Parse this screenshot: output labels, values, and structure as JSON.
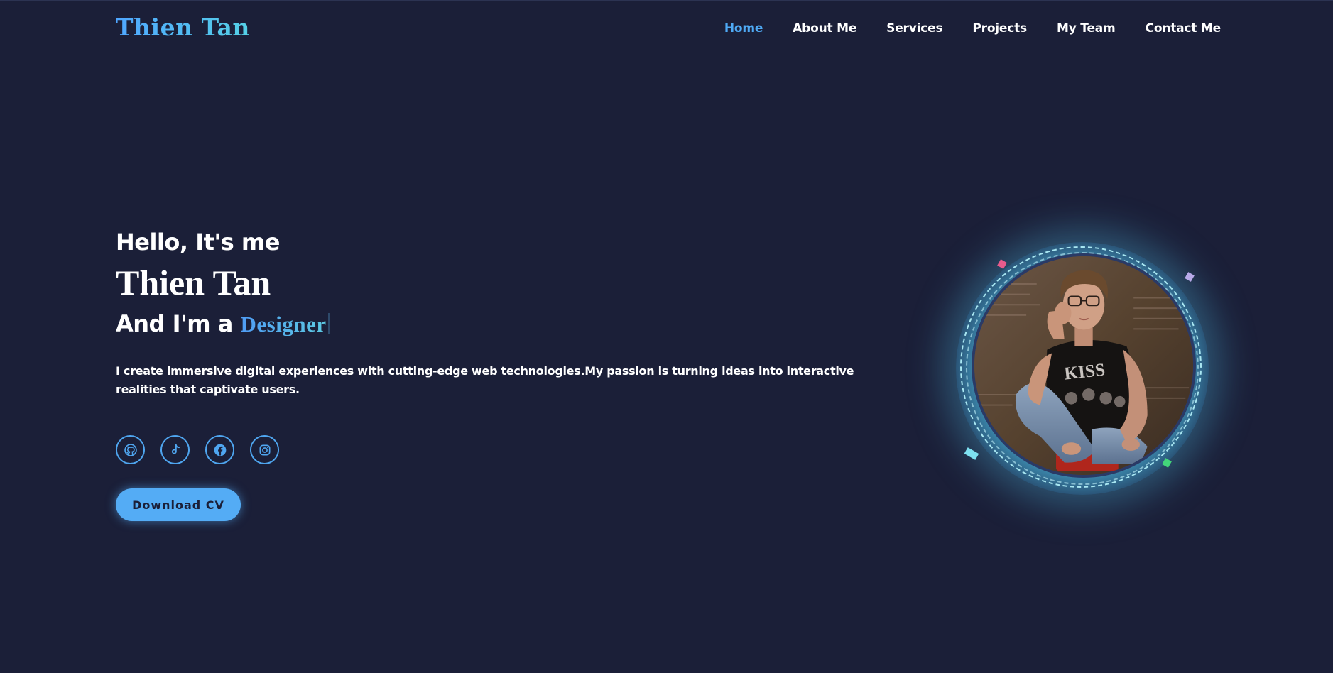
{
  "header": {
    "logo": "Thien Tan",
    "nav": [
      {
        "label": "Home",
        "active": true
      },
      {
        "label": "About Me",
        "active": false
      },
      {
        "label": "Services",
        "active": false
      },
      {
        "label": "Projects",
        "active": false
      },
      {
        "label": "My Team",
        "active": false
      },
      {
        "label": "Contact Me",
        "active": false
      }
    ]
  },
  "hero": {
    "greeting": "Hello, It's me",
    "name": "Thien Tan",
    "role_prefix": "And I'm a ",
    "role": "Designer",
    "description": "I create immersive digital experiences with cutting-edge web technologies.My passion is turning ideas into interactive realities that captivate users.",
    "socials": [
      {
        "icon": "github-icon"
      },
      {
        "icon": "tiktok-icon"
      },
      {
        "icon": "facebook-icon"
      },
      {
        "icon": "instagram-icon"
      }
    ],
    "download_label": "Download CV"
  },
  "portrait": {
    "alt": "portrait-photo"
  },
  "colors": {
    "background": "#1b1f38",
    "accent": "#4faaf5",
    "glow": "#54c8e6"
  }
}
